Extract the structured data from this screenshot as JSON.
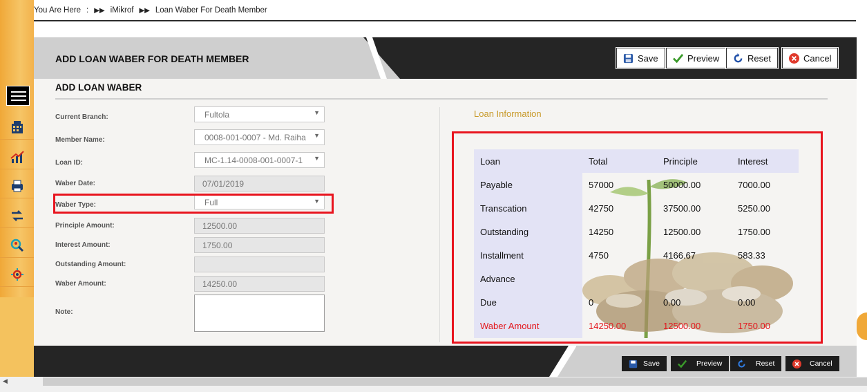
{
  "breadcrumb": {
    "prefix": "You Are Here",
    "colon": ":",
    "items": [
      "iMikrof",
      "Loan Waber For Death Member"
    ]
  },
  "sidebar": {
    "icons": [
      "menu-icon",
      "building-icon",
      "chart-growth-icon",
      "printer-icon",
      "transfer-icon",
      "search-people-icon",
      "gear-network-icon"
    ]
  },
  "header": {
    "title": "ADD LOAN WABER FOR DEATH MEMBER",
    "buttons": {
      "save": "Save",
      "preview": "Preview",
      "reset": "Reset",
      "cancel": "Cancel"
    }
  },
  "section": {
    "title": "ADD LOAN WABER"
  },
  "form": {
    "current_branch": {
      "label": "Current Branch:",
      "value": "Fultola"
    },
    "member_name": {
      "label": "Member Name:",
      "value": "0008-001-0007 - Md. Raiha"
    },
    "loan_id": {
      "label": "Loan ID:",
      "value": "MC-1.14-0008-001-0007-1"
    },
    "waber_date": {
      "label": "Waber Date:",
      "value": "07/01/2019"
    },
    "waber_type": {
      "label": "Waber Type:",
      "value": "Full"
    },
    "principle_amount": {
      "label": "Principle Amount:",
      "value": "12500.00"
    },
    "interest_amount": {
      "label": "Interest Amount:",
      "value": "1750.00"
    },
    "outstanding_amount": {
      "label": "Outstanding Amount:",
      "value": ""
    },
    "waber_amount": {
      "label": "Waber Amount:",
      "value": "14250.00"
    },
    "note": {
      "label": "Note:",
      "value": ""
    }
  },
  "loan_info": {
    "title": "Loan Information",
    "headers": [
      "Loan",
      "Total",
      "Principle",
      "Interest"
    ],
    "rows": [
      [
        "Payable",
        "57000",
        "50000.00",
        "7000.00"
      ],
      [
        "Transcation",
        "42750",
        "37500.00",
        "5250.00"
      ],
      [
        "Outstanding",
        "14250",
        "12500.00",
        "1750.00"
      ],
      [
        "Installment",
        "4750",
        "4166.67",
        "583.33"
      ],
      [
        "Advance",
        "",
        "",
        ""
      ],
      [
        "Due",
        "0",
        "0.00",
        "0.00"
      ],
      [
        "Waber Amount",
        "14250.00",
        "12500.00",
        "1750.00"
      ]
    ],
    "highlight_color": "#e3171d"
  },
  "footer": {
    "buttons": {
      "save": "Save",
      "preview": "Preview",
      "reset": "Reset",
      "cancel": "Cancel"
    }
  },
  "colors": {
    "accent": "#f0a838",
    "dark": "#252525",
    "alert": "#e8141e"
  }
}
